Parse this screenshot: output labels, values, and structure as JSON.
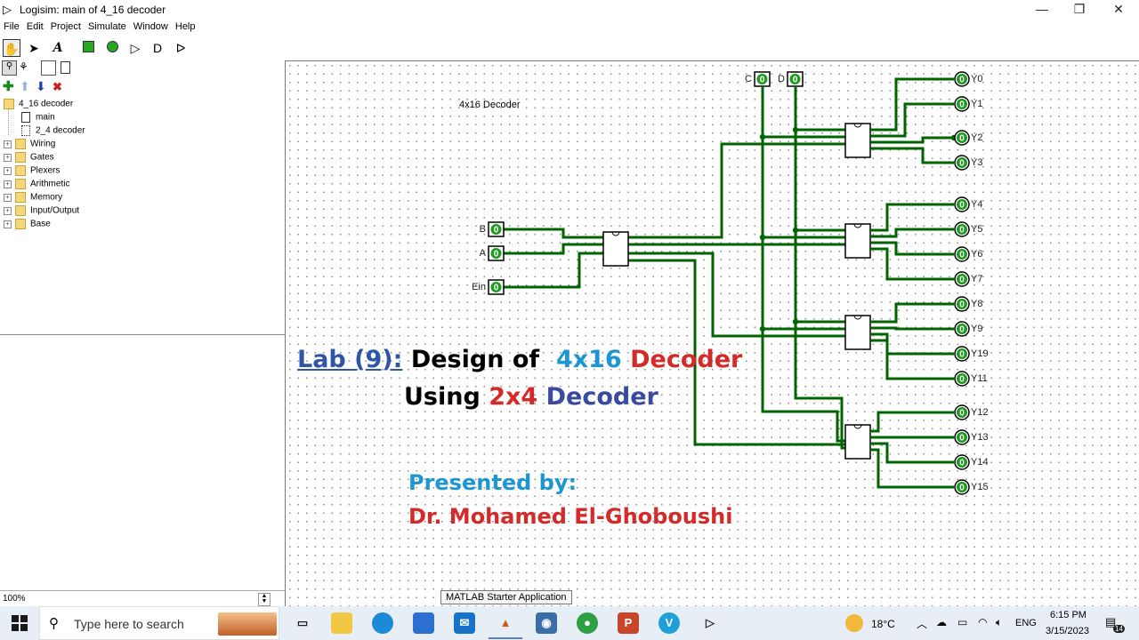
{
  "window": {
    "title": "Logisim: main of 4_16 decoder",
    "minimize_glyph": "—",
    "restore_glyph": "❐",
    "close_glyph": "✕"
  },
  "menu": [
    "File",
    "Edit",
    "Project",
    "Simulate",
    "Window",
    "Help"
  ],
  "explorer": {
    "project": "4_16 decoder",
    "circuits": [
      "main",
      "2_4 decoder"
    ],
    "libraries": [
      "Wiring",
      "Gates",
      "Plexers",
      "Arithmetic",
      "Memory",
      "Input/Output",
      "Base"
    ]
  },
  "zoom": "100%",
  "circuit": {
    "label": "4x16 Decoder",
    "pin_value": "0",
    "inputs": {
      "top": [
        "C",
        "D"
      ],
      "left": [
        "B",
        "A",
        "Ein"
      ]
    },
    "outputs": [
      "Y0",
      "Y1",
      "Y2",
      "Y3",
      "Y4",
      "Y5",
      "Y6",
      "Y7",
      "Y8",
      "Y9",
      "Y19",
      "Y11",
      "Y12",
      "Y13",
      "Y14",
      "Y15"
    ]
  },
  "overlay": {
    "lab": "Lab (9):",
    "design_of": "Design of",
    "size": "4x16",
    "decoder": "Decoder",
    "using": "Using",
    "sub_size": "2x4",
    "sub_decoder": "Decoder",
    "presented": "Presented by:",
    "author": "Dr. Mohamed El-Ghoboushi"
  },
  "tooltip": "MATLAB Starter Application",
  "taskbar": {
    "search_placeholder": "Type here to search",
    "weather": "18°C",
    "lang": "ENG",
    "time": "6:15 PM",
    "date": "3/15/2023",
    "notifications": "14"
  },
  "colors": {
    "wire": "#006400",
    "blue": "#2f55a8",
    "cyan": "#1e96d2",
    "red": "#d42a2a",
    "navy": "#3a4aa0"
  }
}
